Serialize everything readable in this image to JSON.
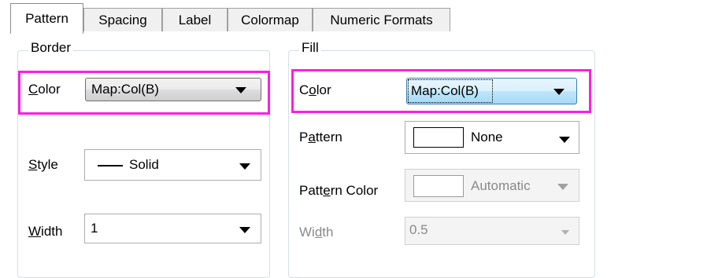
{
  "tabs": [
    {
      "label": "Pattern",
      "active": true
    },
    {
      "label": "Spacing",
      "active": false
    },
    {
      "label": "Label",
      "active": false
    },
    {
      "label": "Colormap",
      "active": false
    },
    {
      "label": "Numeric Formats",
      "active": false
    }
  ],
  "border": {
    "title": "Border",
    "color": {
      "label_accel": "C",
      "label_rest": "olor",
      "value": "Map:Col(B)"
    },
    "style": {
      "label_accel": "S",
      "label_rest": "tyle",
      "value": "Solid"
    },
    "width": {
      "label_accel": "W",
      "label_rest": "idth",
      "value": "1"
    }
  },
  "fill": {
    "title": "Fill",
    "color": {
      "label_pre": "C",
      "label_accel": "o",
      "label_rest": "lor",
      "value": "Map:Col(B)"
    },
    "pattern": {
      "label_pre": "P",
      "label_accel": "a",
      "label_rest": "ttern",
      "value": "None"
    },
    "pattern_color": {
      "label_pre": "Patt",
      "label_accel": "e",
      "label_rest": "rn Color",
      "value": "Automatic",
      "enabled": false
    },
    "width": {
      "label_pre": "Wi",
      "label_accel": "d",
      "label_rest": "th",
      "value": "0.5",
      "enabled": false
    }
  },
  "colors": {
    "highlight": "#ff1ee0",
    "focus_border": "#3c7fb1"
  }
}
